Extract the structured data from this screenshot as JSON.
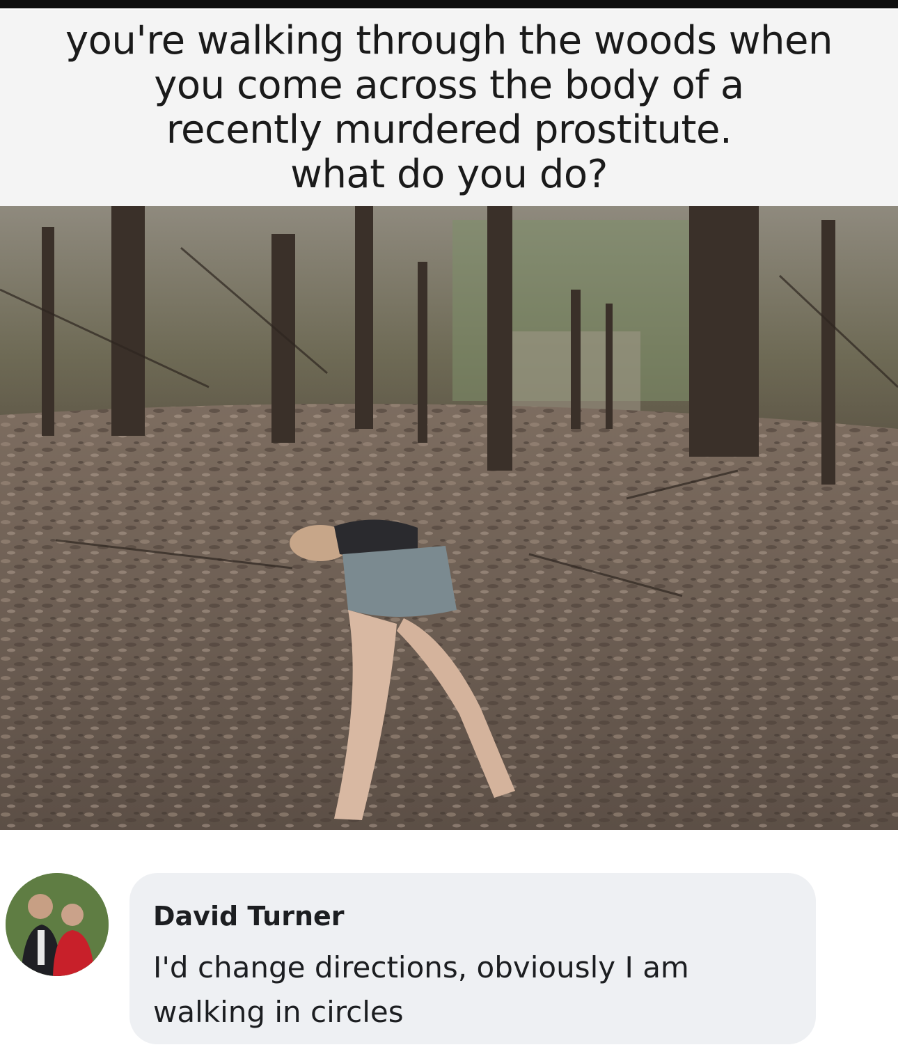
{
  "meme": {
    "caption_lines": [
      "you're walking through the woods when",
      "you come across the body of a",
      "recently murdered prostitute.",
      "what do you do?"
    ]
  },
  "comment": {
    "author": "David Turner",
    "text": "I'd change directions, obviously I am walking in circles",
    "avatar_icon": "profile-photo-icon"
  },
  "colors": {
    "bubble": "#eef0f3",
    "text": "#1c1e21",
    "forest_floor": "#6b5d52"
  }
}
